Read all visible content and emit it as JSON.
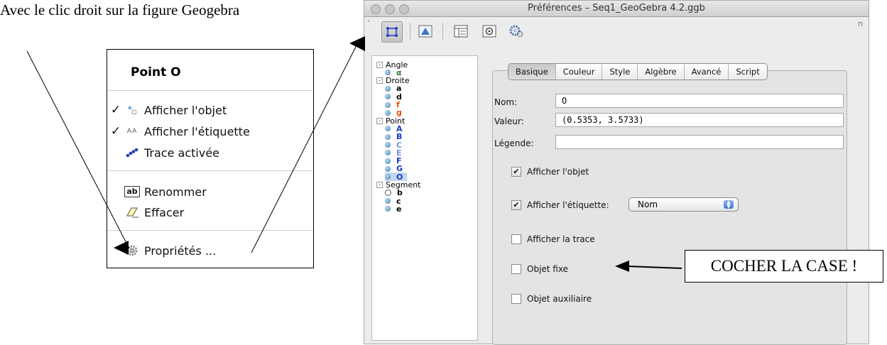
{
  "caption": "Avec le clic droit sur la figure Geogebra",
  "context_menu": {
    "title": "Point O",
    "items": [
      {
        "label": "Afficher l'objet",
        "checked": "✓"
      },
      {
        "label": "Afficher l'étiquette",
        "checked": "✓"
      },
      {
        "label": "Trace activée",
        "checked": ""
      },
      {
        "label": "Renommer",
        "checked": ""
      },
      {
        "label": "Effacer",
        "checked": ""
      },
      {
        "label": "Propriétés ...",
        "checked": ""
      }
    ],
    "label_icon_text": "AA",
    "rename_icon_text": "ab"
  },
  "window": {
    "title": "Préférences – Seq1_GeoGebra 4.2.ggb",
    "tree": [
      {
        "label": "Angle",
        "type": "group"
      },
      {
        "label": "α",
        "type": "leaf",
        "color": "#2e7d32"
      },
      {
        "label": "Droite",
        "type": "group"
      },
      {
        "label": "a",
        "type": "leaf",
        "color": "#000000"
      },
      {
        "label": "d",
        "type": "leaf",
        "color": "#000000"
      },
      {
        "label": "f",
        "type": "leaf",
        "color": "#e65100"
      },
      {
        "label": "g",
        "type": "leaf",
        "color": "#e65100"
      },
      {
        "label": "Point",
        "type": "group"
      },
      {
        "label": "A",
        "type": "leaf",
        "color": "#1a3dc4"
      },
      {
        "label": "B",
        "type": "leaf",
        "color": "#1a3dc4"
      },
      {
        "label": "C",
        "type": "leaf",
        "color": "#7a8fd8"
      },
      {
        "label": "E",
        "type": "leaf",
        "color": "#7a8fd8"
      },
      {
        "label": "F",
        "type": "leaf",
        "color": "#1a3dc4"
      },
      {
        "label": "G",
        "type": "leaf",
        "color": "#1a3dc4"
      },
      {
        "label": "O",
        "type": "leaf",
        "color": "#1a3dc4",
        "selected": true
      },
      {
        "label": "Segment",
        "type": "group"
      },
      {
        "label": "b",
        "type": "leaf-hidden",
        "color": "#000000"
      },
      {
        "label": "c",
        "type": "leaf",
        "color": "#000000"
      },
      {
        "label": "e",
        "type": "leaf",
        "color": "#000000"
      }
    ],
    "tabs": [
      "Basique",
      "Couleur",
      "Style",
      "Algèbre",
      "Avancé",
      "Script"
    ],
    "active_tab": "Basique",
    "fields": {
      "nom_label": "Nom:",
      "nom_value": "O",
      "valeur_label": "Valeur:",
      "valeur_value": "(0.5353, 3.5733)",
      "legende_label": "Légende:",
      "legende_value": ""
    },
    "checkboxes": [
      {
        "label": "Afficher l'objet",
        "checked": true
      },
      {
        "label": "Afficher l'étiquette:",
        "checked": true
      },
      {
        "label": "Afficher la trace",
        "checked": false
      },
      {
        "label": "Objet fixe",
        "checked": false
      },
      {
        "label": "Objet auxiliaire",
        "checked": false
      }
    ],
    "label_mode_select": "Nom"
  },
  "callout": "COCHER LA CASE !"
}
